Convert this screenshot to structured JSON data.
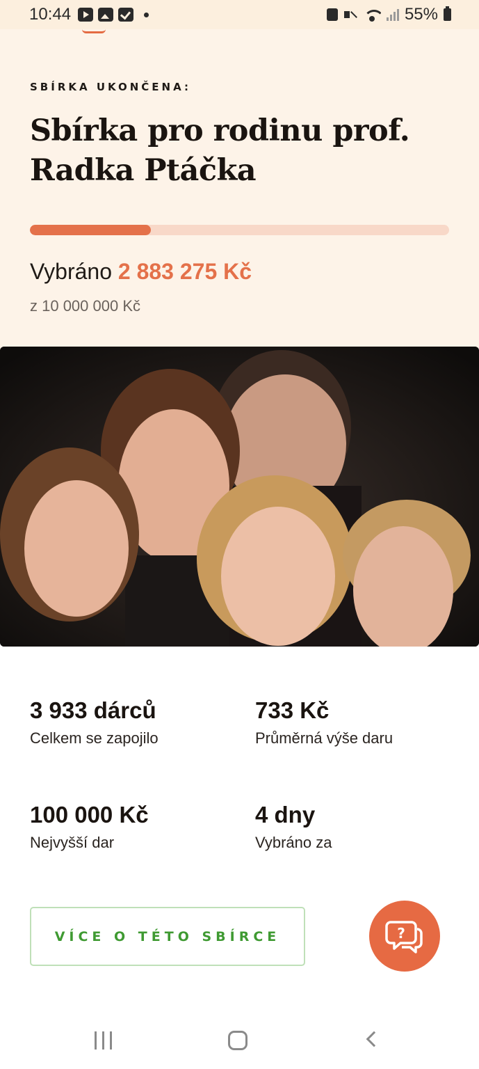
{
  "status_bar": {
    "time": "10:44",
    "battery": "55%",
    "icons": [
      "youtube-icon",
      "gallery-icon",
      "tasks-icon",
      "dot-icon",
      "sim-icon",
      "mute-icon",
      "wifi-icon",
      "signal-icon",
      "battery-icon"
    ]
  },
  "campaign": {
    "status_label": "SBÍRKA UKONČENA:",
    "title": "Sbírka pro rodinu prof. Radka Ptáčka",
    "raised_prefix": "Vybráno",
    "raised_amount": "2 883 275 Kč",
    "goal_text": "z 10 000 000 Kč",
    "progress_fraction": 0.288
  },
  "stats": [
    {
      "value": "3 933 dárců",
      "label": "Celkem se zapojilo"
    },
    {
      "value": "733 Kč",
      "label": "Průměrná výše daru"
    },
    {
      "value": "100 000 Kč",
      "label": "Nejvyšší dar"
    },
    {
      "value": "4 dny",
      "label": "Vybráno za"
    }
  ],
  "actions": {
    "more_label": "VÍCE O TÉTO SBÍRCE",
    "help_icon": "help-chat-icon"
  },
  "nav": {
    "icons": [
      "recent-apps-icon",
      "home-icon",
      "back-icon"
    ]
  },
  "colors": {
    "accent": "#e4714a",
    "hero_bg": "#fdf3e8",
    "progress_track": "#f8d8c8",
    "button_text": "#3f9a32",
    "button_border": "#bfe0b8"
  }
}
